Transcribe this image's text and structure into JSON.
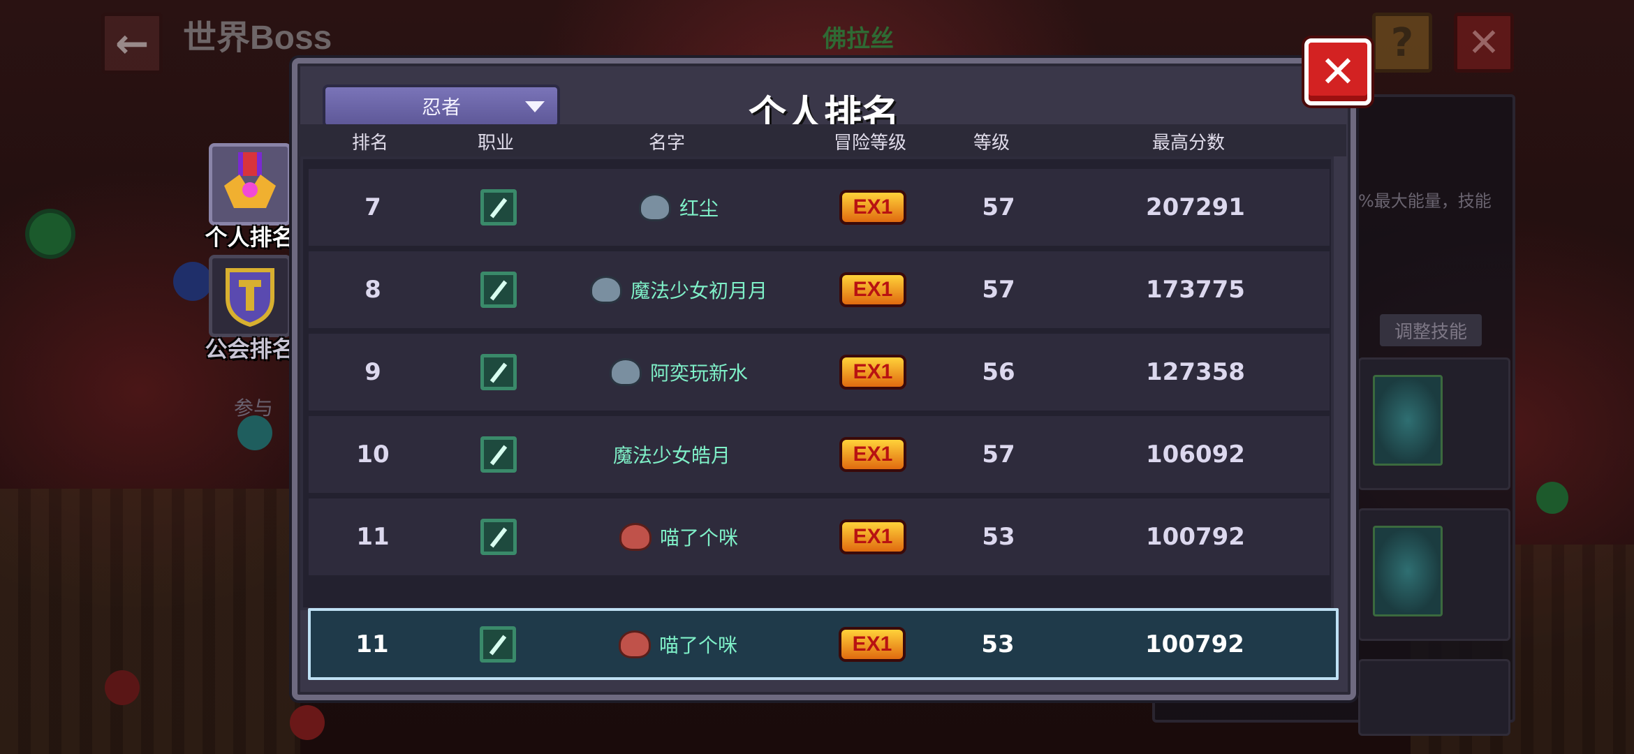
{
  "top_bar": {
    "back_icon": "←",
    "title": "世界Boss",
    "boss_name": "佛拉丝",
    "help_icon": "?",
    "close_icon": "✕"
  },
  "side_panel": {
    "text": "%最大能量，技能",
    "adjust_button": "调整技能"
  },
  "tabs": [
    {
      "label": "个人排名",
      "active": true
    },
    {
      "label": "公会排名",
      "active": false
    }
  ],
  "participate_text": "参与",
  "modal": {
    "title": "个人排名",
    "close_icon": "✕",
    "dropdown": {
      "selected": "忍者"
    },
    "columns": [
      "排名",
      "职业",
      "名字",
      "冒险等级",
      "等级",
      "最高分数"
    ],
    "rows": [
      {
        "rank": "7",
        "name": "红尘",
        "adventure_level": "EX1",
        "level": "57",
        "score": "207291",
        "avatar": "gray"
      },
      {
        "rank": "8",
        "name": "魔法少女初月月",
        "adventure_level": "EX1",
        "level": "57",
        "score": "173775",
        "avatar": "gray"
      },
      {
        "rank": "9",
        "name": "阿奕玩新水",
        "adventure_level": "EX1",
        "level": "56",
        "score": "127358",
        "avatar": "gray"
      },
      {
        "rank": "10",
        "name": "魔法少女皓月",
        "adventure_level": "EX1",
        "level": "57",
        "score": "106092",
        "avatar": "none"
      },
      {
        "rank": "11",
        "name": "喵了个咪",
        "adventure_level": "EX1",
        "level": "53",
        "score": "100792",
        "avatar": "red"
      }
    ],
    "my_row": {
      "rank": "11",
      "name": "喵了个咪",
      "adventure_level": "EX1",
      "level": "53",
      "score": "100792",
      "avatar": "red"
    }
  },
  "colors": {
    "modal_bg": "#3a3749",
    "row_bg": "#2e2b3c",
    "name_text": "#7ff0c8",
    "highlight_row": "#1f3a4a",
    "close_red": "#d32222",
    "dropdown": "#6e68ac"
  }
}
